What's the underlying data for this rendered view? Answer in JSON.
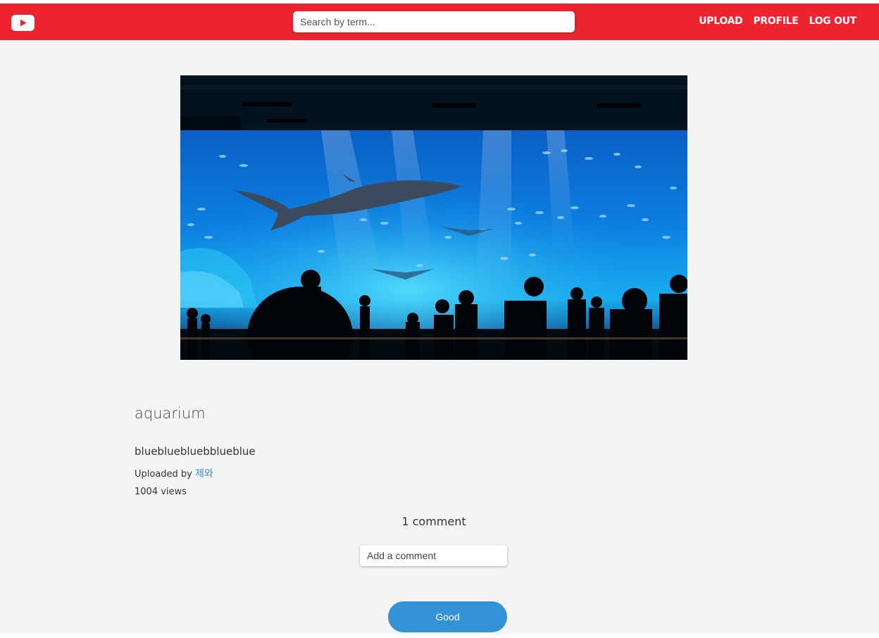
{
  "app": {
    "logo_icon": "youtube-play-icon",
    "brand_color": "#ed2330"
  },
  "header": {
    "search_placeholder": "Search by term...",
    "nav": {
      "upload": "UPLOAD",
      "profile": "PROFILE",
      "logout": "LOG OUT"
    }
  },
  "video": {
    "title": "aquarium",
    "description": "bluebluebluebblueblue",
    "uploaded_prefix": "Uploaded by",
    "uploader": "제와",
    "views": "1004 views"
  },
  "comments": {
    "count_label": "1 comment",
    "input_placeholder": "Add a comment",
    "submit_label": "Good",
    "button_color": "#3492d6"
  }
}
